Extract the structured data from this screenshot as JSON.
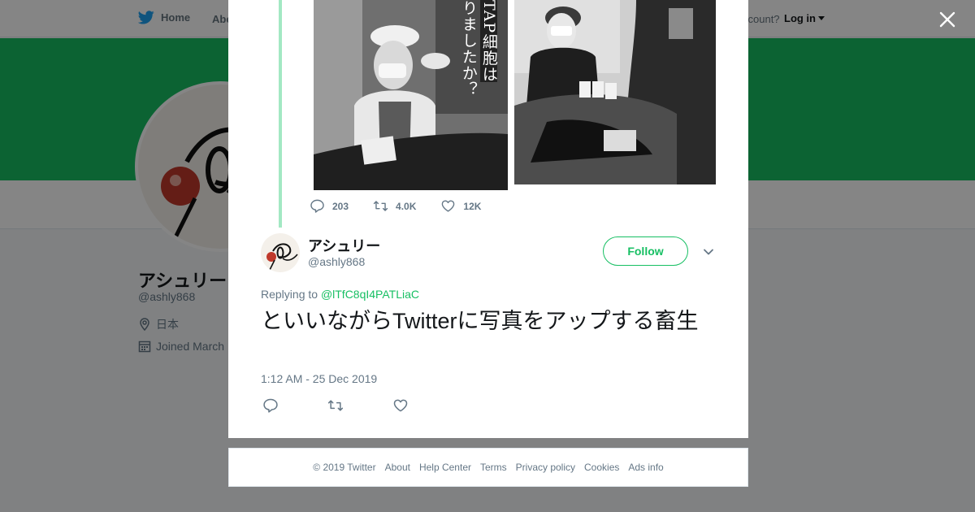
{
  "nav": {
    "home_label": "Home",
    "about_label": "Abo",
    "account_prompt": "ccount?",
    "login_label": "Log in"
  },
  "profile": {
    "name": "アシュリー",
    "handle": "@ashly868",
    "location": "日本",
    "joined": "Joined March"
  },
  "images": {
    "left_vertical_text_1": "TAP細胞は",
    "left_vertical_text_2": "りましたか？"
  },
  "quoted_stats": {
    "replies": "203",
    "retweets": "4.0K",
    "likes": "12K"
  },
  "tweet": {
    "author_name": "アシュリー",
    "author_handle": "@ashly868",
    "follow_label": "Follow",
    "replying_prefix": "Replying to ",
    "replying_to": "@lTfC8qI4PATLiaC",
    "text": "といいながらTwitterに写真をアップする畜生",
    "timestamp": "1:12 AM - 25 Dec 2019"
  },
  "footer": {
    "links": [
      "© 2019 Twitter",
      "About",
      "Help Center",
      "Terms",
      "Privacy policy",
      "Cookies",
      "Ads info"
    ]
  },
  "colors": {
    "brand_green": "#17bf63",
    "twitter_blue": "#1da1f2",
    "thread_line": "#a3e8c3",
    "muted_text": "#657786"
  },
  "icons": {
    "home": "twitter-bird-icon",
    "close": "close-icon",
    "location": "location-pin-icon",
    "calendar": "calendar-icon",
    "reply": "reply-icon",
    "retweet": "retweet-icon",
    "like": "heart-icon",
    "caret": "chevron-down-icon"
  }
}
